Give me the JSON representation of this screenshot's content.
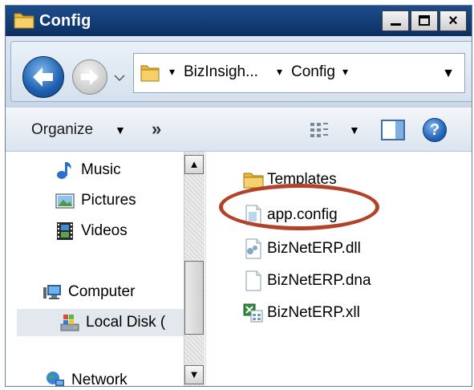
{
  "window": {
    "title": "Config"
  },
  "address_bar": {
    "crumbs": [
      "BizInsigh...",
      "Config"
    ]
  },
  "command_bar": {
    "organize_label": "Organize",
    "more_label": "»"
  },
  "navigation_pane": {
    "items": [
      {
        "label": "Music",
        "icon": "music-note-icon"
      },
      {
        "label": "Pictures",
        "icon": "pictures-icon"
      },
      {
        "label": "Videos",
        "icon": "film-strip-icon"
      },
      {
        "label": "Computer",
        "icon": "computer-icon"
      },
      {
        "label": "Local Disk (",
        "icon": "local-disk-icon"
      },
      {
        "label": "Network",
        "icon": "network-icon"
      }
    ]
  },
  "file_list": {
    "items": [
      {
        "name": "Templates",
        "icon": "folder-icon"
      },
      {
        "name": "app.config",
        "icon": "config-file-icon",
        "highlighted": true
      },
      {
        "name": "BizNetERP.dll",
        "icon": "dll-file-icon"
      },
      {
        "name": "BizNetERP.dna",
        "icon": "generic-file-icon"
      },
      {
        "name": "BizNetERP.xll",
        "icon": "excel-addin-icon"
      }
    ]
  },
  "colors": {
    "title_bar": "#0c2f63",
    "highlight_ring": "#b2432b"
  }
}
